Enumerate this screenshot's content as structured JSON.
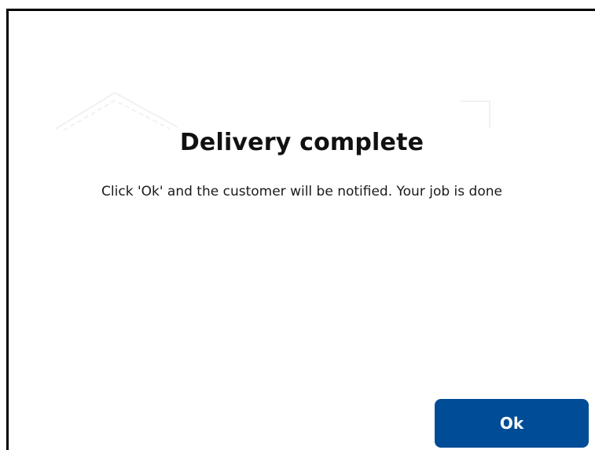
{
  "dialog": {
    "title": "Delivery complete",
    "message": "Click 'Ok' and the customer will be notified. Your job is done",
    "ok_label": "Ok"
  },
  "colors": {
    "button_background": "#004c97",
    "button_text": "#ffffff",
    "border": "#000000"
  }
}
